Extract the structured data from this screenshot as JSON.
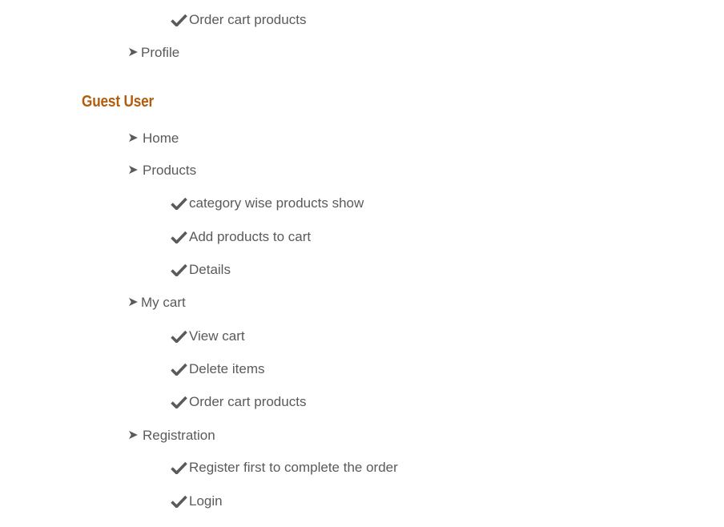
{
  "top_section": {
    "items": [
      {
        "label": "Order cart products",
        "icon": "check-icon"
      },
      {
        "label": "Profile",
        "icon": "arrow-right-icon"
      }
    ]
  },
  "guest_section": {
    "heading": "Guest User",
    "heading_color": "#b35c0d",
    "items": [
      {
        "label": "Home",
        "icon": "arrow-right-icon"
      },
      {
        "label": "Products",
        "icon": "arrow-right-icon"
      },
      {
        "label": "category wise products show",
        "icon": "check-icon"
      },
      {
        "label": "Add products to cart",
        "icon": "check-icon"
      },
      {
        "label": "Details",
        "icon": "check-icon"
      },
      {
        "label": "My cart",
        "icon": "arrow-right-icon"
      },
      {
        "label": "View cart",
        "icon": "check-icon"
      },
      {
        "label": "Delete items",
        "icon": "check-icon"
      },
      {
        "label": "Order cart products",
        "icon": "check-icon"
      },
      {
        "label": "Registration",
        "icon": "arrow-right-icon"
      },
      {
        "label": "Register first to complete the order",
        "icon": "check-icon"
      },
      {
        "label": "Login",
        "icon": "check-icon"
      }
    ]
  },
  "text_color": "#5a5a5a"
}
